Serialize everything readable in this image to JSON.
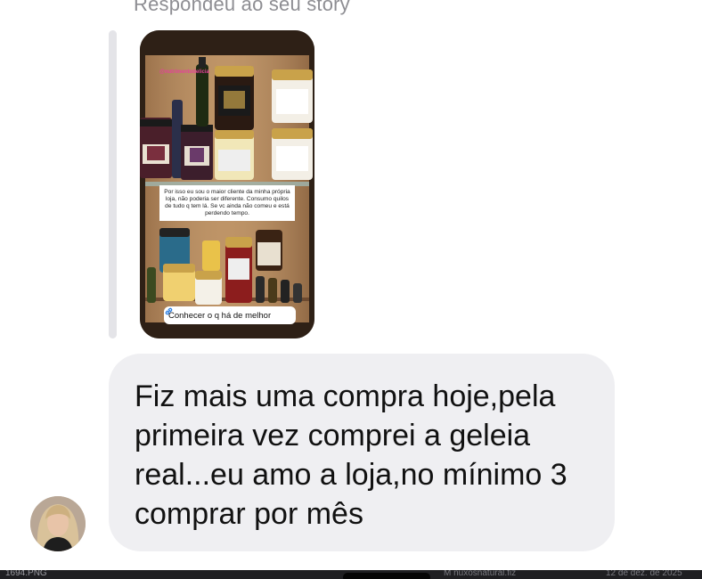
{
  "thread": {
    "reply_label": "Respondeu ao seu story"
  },
  "story": {
    "handle": "@nutrimentodelicia",
    "caption": "Por isso eu sou o maior cliente da minha própria loja, não poderia ser diferente. Consumo quilos de tudo q tem lá. Se vc ainda não comeu e está perdendo tempo.",
    "link_label": "Conhecer o q há de melhor",
    "link_icon": "link-icon"
  },
  "message": {
    "text": "Fiz mais uma compra hoje,pela\nprimeira vez comprei a geleia\nreal...eu amo a loja,no mínimo 3\ncomprar por mês",
    "avatar_icon": "user-avatar"
  },
  "taskbar": {
    "file_name": "1694.PNG",
    "app_name": "M  nuxosnatural.fiz",
    "date": "12 de dez. de 2025"
  }
}
